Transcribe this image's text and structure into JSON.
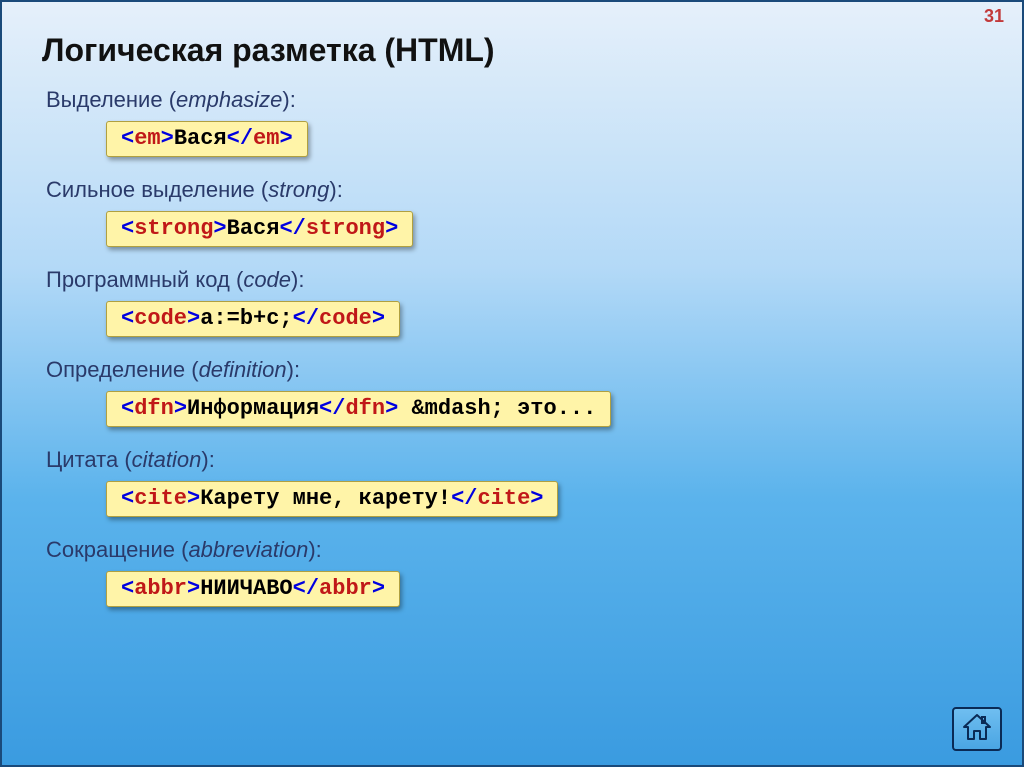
{
  "page_number": "31",
  "title": "Логическая разметка (HTML)",
  "sections": [
    {
      "label_ru": "Выделение",
      "label_en": "emphasize",
      "tag": "em",
      "content": "Вася",
      "suffix": ""
    },
    {
      "label_ru": "Сильное выделение",
      "label_en": "strong",
      "tag": "strong",
      "content": "Вася",
      "suffix": ""
    },
    {
      "label_ru": "Программный код",
      "label_en": "code",
      "tag": "code",
      "content": "a:=b+c;",
      "suffix": ""
    },
    {
      "label_ru": "Определение",
      "label_en": "definition",
      "tag": "dfn",
      "content": "Информация",
      "suffix": " &mdash; это..."
    },
    {
      "label_ru": "Цитата",
      "label_en": "citation",
      "tag": "cite",
      "content": "Карету мне, карету!",
      "suffix": ""
    },
    {
      "label_ru": "Сокращение",
      "label_en": "abbreviation",
      "tag": "abbr",
      "content": "НИИЧАВО",
      "suffix": ""
    }
  ]
}
